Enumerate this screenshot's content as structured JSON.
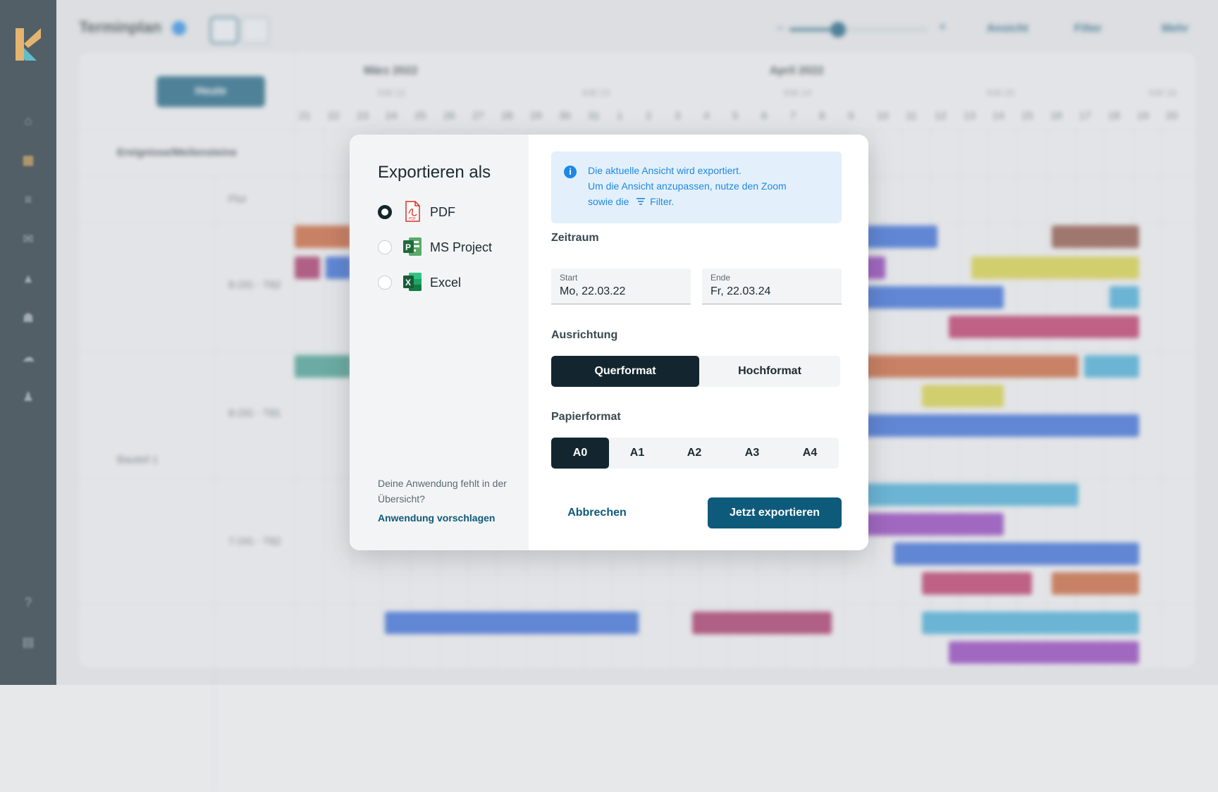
{
  "app": {
    "page_title": "Terminplan",
    "actions": [
      {
        "label": "Ansicht",
        "icon": "view-icon"
      },
      {
        "label": "Filter",
        "icon": "filter-icon"
      },
      {
        "label": "Mehr",
        "icon": "more-icon"
      }
    ],
    "today_button": "Heute",
    "events_header": "Ereignisse/Meilensteine",
    "months": [
      "März 2022",
      "April 2022"
    ],
    "weeks": [
      "KW 12",
      "KW 13",
      "KW 14",
      "KW 15",
      "KW 16"
    ],
    "days": [
      "21",
      "22",
      "23",
      "24",
      "25",
      "26",
      "27",
      "28",
      "29",
      "30",
      "31",
      "1",
      "2",
      "3",
      "4",
      "5",
      "6",
      "7",
      "8",
      "9",
      "10",
      "11",
      "12",
      "13",
      "14",
      "15",
      "16",
      "17",
      "18",
      "19",
      "20"
    ],
    "row_labels": [
      "Flur",
      "8.OG - T82",
      "8.OG - T81",
      "7.OG - T82"
    ],
    "group_label": "Bauteil 1"
  },
  "modal": {
    "title": "Exportieren als",
    "formats": [
      {
        "label": "PDF",
        "icon": "pdf-file-icon",
        "selected": true
      },
      {
        "label": "MS Project",
        "icon": "ms-project-icon",
        "selected": false
      },
      {
        "label": "Excel",
        "icon": "excel-icon",
        "selected": false
      }
    ],
    "missing_text": "Deine Anwendung fehlt in der Übersicht?",
    "suggest_link": "Anwendung vorschlagen",
    "info": {
      "line1": "Die aktuelle Ansicht wird exportiert.",
      "line2": "Um die Ansicht anzupassen, nutze den Zoom",
      "line3_prefix": "sowie die",
      "line3_filter": "Filter."
    },
    "zeitraum_label": "Zeitraum",
    "start_label": "Start",
    "start_value": "Mo, 22.03.22",
    "end_label": "Ende",
    "end_value": "Fr, 22.03.24",
    "orientation_label": "Ausrichtung",
    "orientations": [
      "Querformat",
      "Hochformat"
    ],
    "orientation_selected": "Querformat",
    "paper_label": "Papierformat",
    "papers": [
      "A0",
      "A1",
      "A2",
      "A3",
      "A4"
    ],
    "paper_selected": "A0",
    "cancel_label": "Abbrechen",
    "export_label": "Jetzt exportieren"
  },
  "colors": {
    "accent": "#0e5a7a",
    "sidebar": "#13262f",
    "info_blue": "#1e88e5"
  }
}
